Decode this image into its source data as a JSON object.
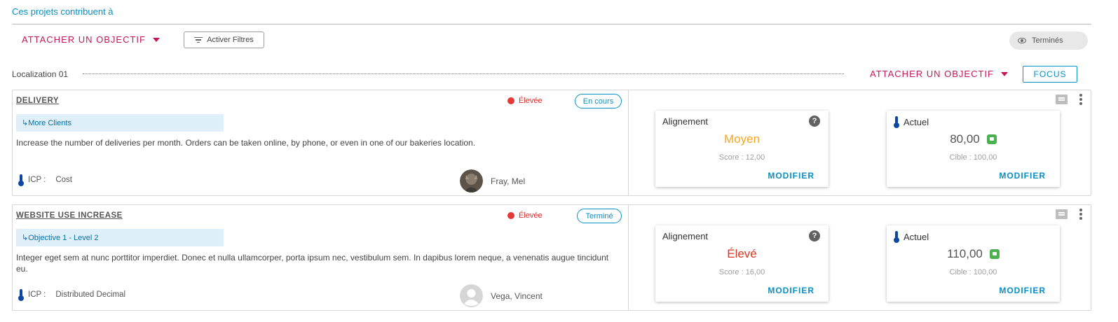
{
  "header": {
    "title": "Ces projets contribuent à",
    "attach_label": "ATTACHER UN OBJECTIF",
    "filters_label": "Activer Filtres",
    "termines_label": "Terminés"
  },
  "group": {
    "label": "Localization 01",
    "attach_label": "ATTACHER UN OBJECTIF",
    "focus_label": "FOCUS"
  },
  "projects": [
    {
      "title": "DELIVERY",
      "priority": "Élevée",
      "status": "En cours",
      "objective": "↳More Clients",
      "description": "Increase the number of deliveries per month. Orders can be taken online, by phone, or even in one of our bakeries location.",
      "icp_label": "ICP :",
      "icp_value": "Cost",
      "owner": "Fray, Mel",
      "alignment_title": "Alignement",
      "alignment_value": "Moyen",
      "alignment_color": "#f5a623",
      "score_text": "Score :  12,00",
      "actual_title": "Actuel",
      "actual_value": "80,00",
      "target_text": "Cible :  100,00",
      "modify_label": "MODIFIER"
    },
    {
      "title": "WEBSITE USE INCREASE",
      "priority": "Élevée",
      "status": "Terminé",
      "objective": "↳Objective 1 - Level 2",
      "description": "Integer eget sem at nunc porttitor imperdiet. Donec et nulla ullamcorper, porta ipsum nec, vestibulum sem. In dapibus lorem neque, a venenatis augue tincidunt eu.",
      "icp_label": "ICP :",
      "icp_value": "Distributed Decimal",
      "owner": "Vega, Vincent",
      "alignment_title": "Alignement",
      "alignment_value": "Élevé",
      "alignment_color": "#d9361f",
      "score_text": "Score :  16,00",
      "actual_title": "Actuel",
      "actual_value": "110,00",
      "target_text": "Cible :  100,00",
      "modify_label": "MODIFIER"
    }
  ],
  "colors": {
    "accent_blue": "#0a8fc2",
    "accent_magenta": "#c2185b",
    "priority_red": "#e53935",
    "thumb_green": "#4caf50"
  },
  "icons": [
    "filter-icon",
    "eye-icon",
    "thermometer-icon",
    "help-icon",
    "thumbs-up-icon",
    "comment-icon",
    "more-vert-icon",
    "avatar"
  ]
}
